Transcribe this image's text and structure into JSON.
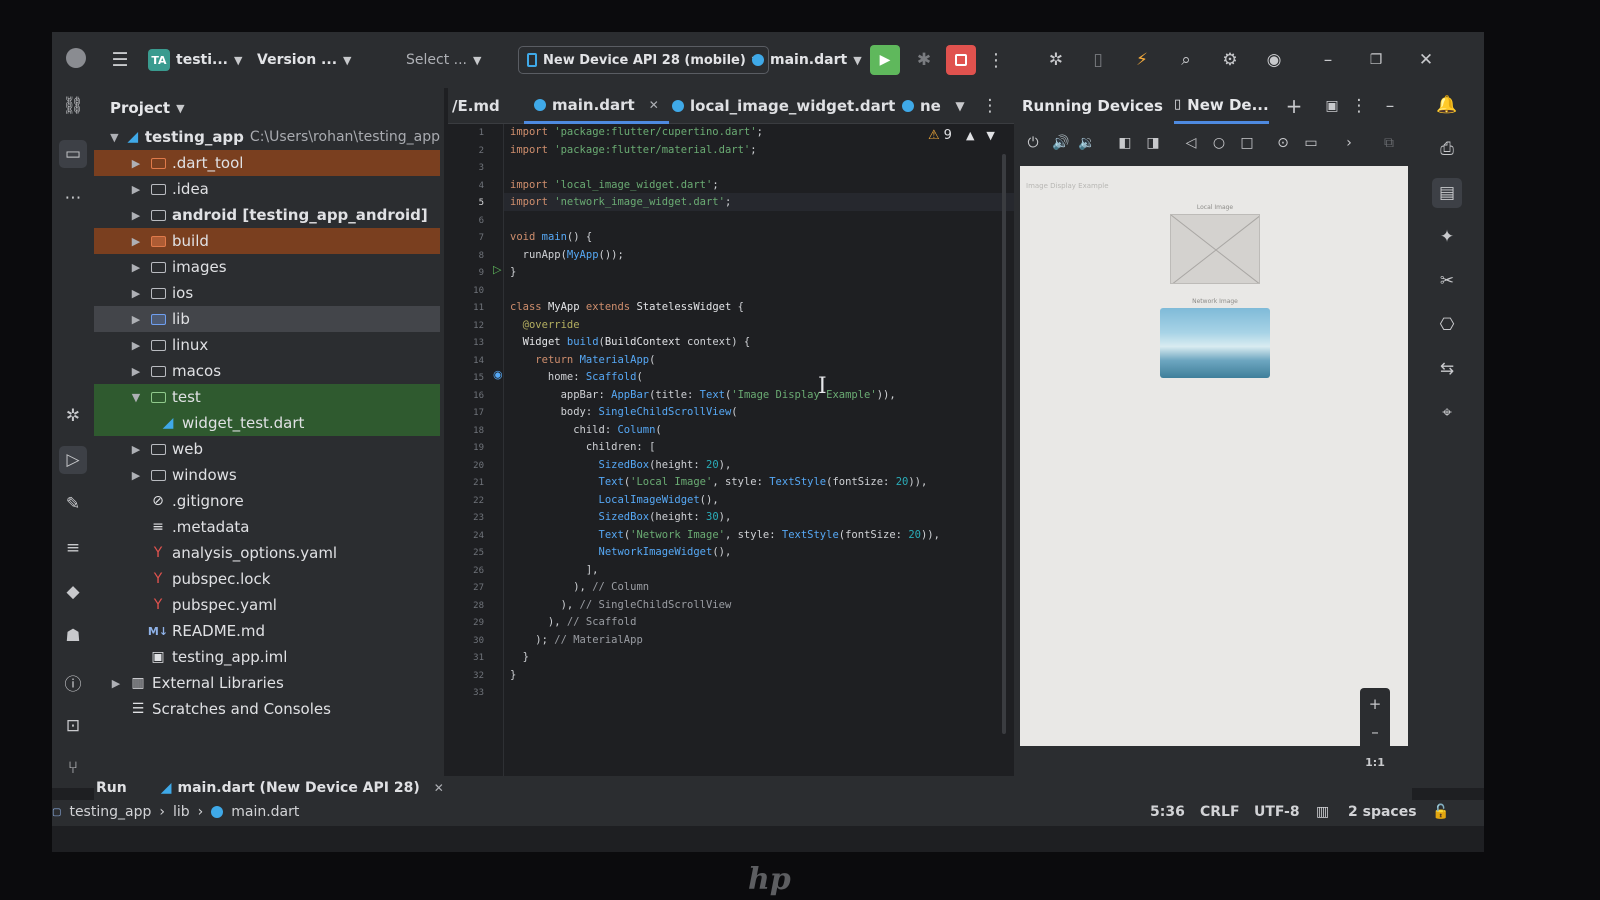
{
  "titlebar": {
    "project_badge": "TA",
    "project_name": "testi...",
    "version": "Version ...",
    "select": "Select ...",
    "device": "New Device API 28 (mobile)",
    "run_config": "main.dart"
  },
  "project_panel": {
    "title": "Project",
    "root_name": "testing_app",
    "root_path": "C:\\Users\\rohan\\testing_app",
    "items": [
      {
        "label": "dart_tool",
        "display": ".dart_tool"
      },
      {
        "label": ".idea"
      },
      {
        "label": "android [testing_app_android]"
      },
      {
        "label": "build"
      },
      {
        "label": "images"
      },
      {
        "label": "ios"
      },
      {
        "label": "lib"
      },
      {
        "label": "linux"
      },
      {
        "label": "macos"
      },
      {
        "label": "test"
      },
      {
        "label": "widget_test.dart"
      },
      {
        "label": "web"
      },
      {
        "label": "windows"
      },
      {
        "label": ".gitignore"
      },
      {
        "label": ".metadata"
      },
      {
        "label": "analysis_options.yaml"
      },
      {
        "label": "pubspec.lock"
      },
      {
        "label": "pubspec.yaml"
      },
      {
        "label": "README.md"
      },
      {
        "label": "testing_app.iml"
      },
      {
        "label": "External Libraries"
      },
      {
        "label": "Scratches and Consoles"
      }
    ]
  },
  "editor": {
    "tabs": [
      "/E.md",
      "main.dart",
      "local_image_widget.dart",
      "ne"
    ],
    "warning_count": "9",
    "line_numbers": [
      "1",
      "2",
      "3",
      "4",
      "5",
      "6",
      "7",
      "8",
      "9",
      "10",
      "11",
      "12",
      "13",
      "14",
      "15",
      "16",
      "17",
      "18",
      "19",
      "20",
      "21",
      "22",
      "23",
      "24",
      "25",
      "26",
      "27",
      "28",
      "29",
      "30",
      "31",
      "32",
      "33"
    ]
  },
  "devices": {
    "title": "Running Devices",
    "tab": "New De...",
    "app_title": "Image Display Example",
    "local_label": "Local Image",
    "network_label": "Network Image",
    "zoom_ratio": "1:1"
  },
  "runbar": {
    "label": "Run",
    "config": "main.dart (New Device API 28)"
  },
  "statusbar": {
    "breadcrumb": [
      "testing_app",
      "lib",
      "main.dart"
    ],
    "position": "5:36",
    "line_ending": "CRLF",
    "encoding": "UTF-8",
    "indent": "2 spaces"
  }
}
